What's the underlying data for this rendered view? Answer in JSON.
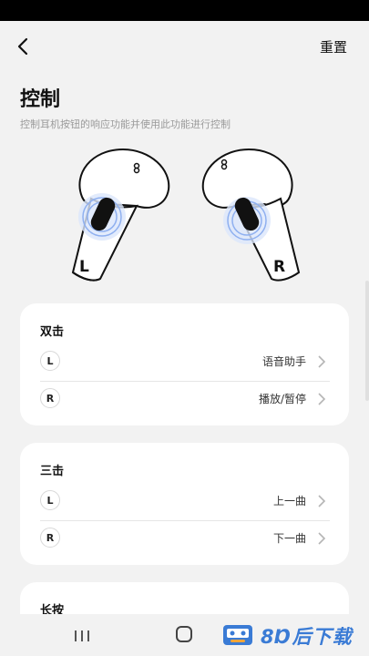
{
  "header": {
    "reset_label": "重置"
  },
  "page": {
    "title": "控制",
    "description": "控制耳机按钮的响应功能并使用此功能进行控制"
  },
  "earbuds": {
    "left_letter": "L",
    "right_letter": "R"
  },
  "sections": [
    {
      "title": "双击",
      "rows": [
        {
          "side": "L",
          "value": "语音助手"
        },
        {
          "side": "R",
          "value": "播放/暂停"
        }
      ]
    },
    {
      "title": "三击",
      "rows": [
        {
          "side": "L",
          "value": "上一曲"
        },
        {
          "side": "R",
          "value": "下一曲"
        }
      ]
    },
    {
      "title": "长按"
    }
  ],
  "watermark": {
    "text": "8Ɒ后下载"
  },
  "colors": {
    "background": "#f2f2f2",
    "card": "#ffffff",
    "touch_glow": "#8fb0f0",
    "watermark": "#3a7bd5"
  }
}
